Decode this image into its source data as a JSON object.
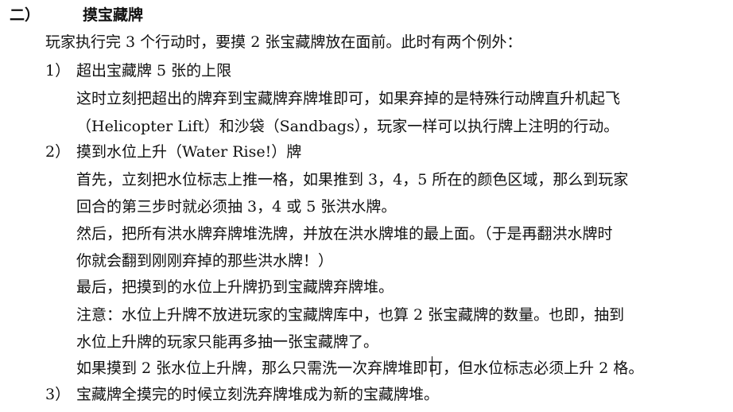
{
  "section": {
    "number": "二）",
    "title": "摸宝藏牌"
  },
  "intro": "玩家执行完 3 个行动时，要摸 2 张宝藏牌放在面前。此时有两个例外：",
  "items": [
    {
      "number": "1）",
      "title": "超出宝藏牌 5 张的上限",
      "lines": [
        "这时立刻把超出的牌弃到宝藏牌弃牌堆即可，如果弃掉的是特殊行动牌直升机起飞",
        "（Helicopter Lift）和沙袋（Sandbags），玩家一样可以执行牌上注明的行动。"
      ]
    },
    {
      "number": "2）",
      "title": "摸到水位上升（Water Rise!）牌",
      "lines": [
        "首先，立刻把水位标志上推一格，如果推到 3，4，5 所在的颜色区域，那么到玩家",
        "回合的第三步时就必须抽 3，4 或 5 张洪水牌。",
        "然后，把所有洪水牌弃牌堆洗牌，并放在洪水牌堆的最上面。（于是再翻洪水牌时",
        "你就会翻到刚刚弃掉的那些洪水牌！）",
        "最后，把摸到的水位上升牌扔到宝藏牌弃牌堆。",
        "注意：水位上升牌不放进玩家的宝藏牌库中，也算 2 张宝藏牌的数量。也即，抽到",
        "水位上升牌的玩家只能再多抽一张宝藏牌了。",
        "如果摸到 2 张水位上升牌，那么只需洗一次弃牌堆即可，但水位标志必须上升 2 格。"
      ]
    },
    {
      "number": "3）",
      "title": "宝藏牌全摸完的时候立刻洗弃牌堆成为新的宝藏牌堆。"
    }
  ]
}
